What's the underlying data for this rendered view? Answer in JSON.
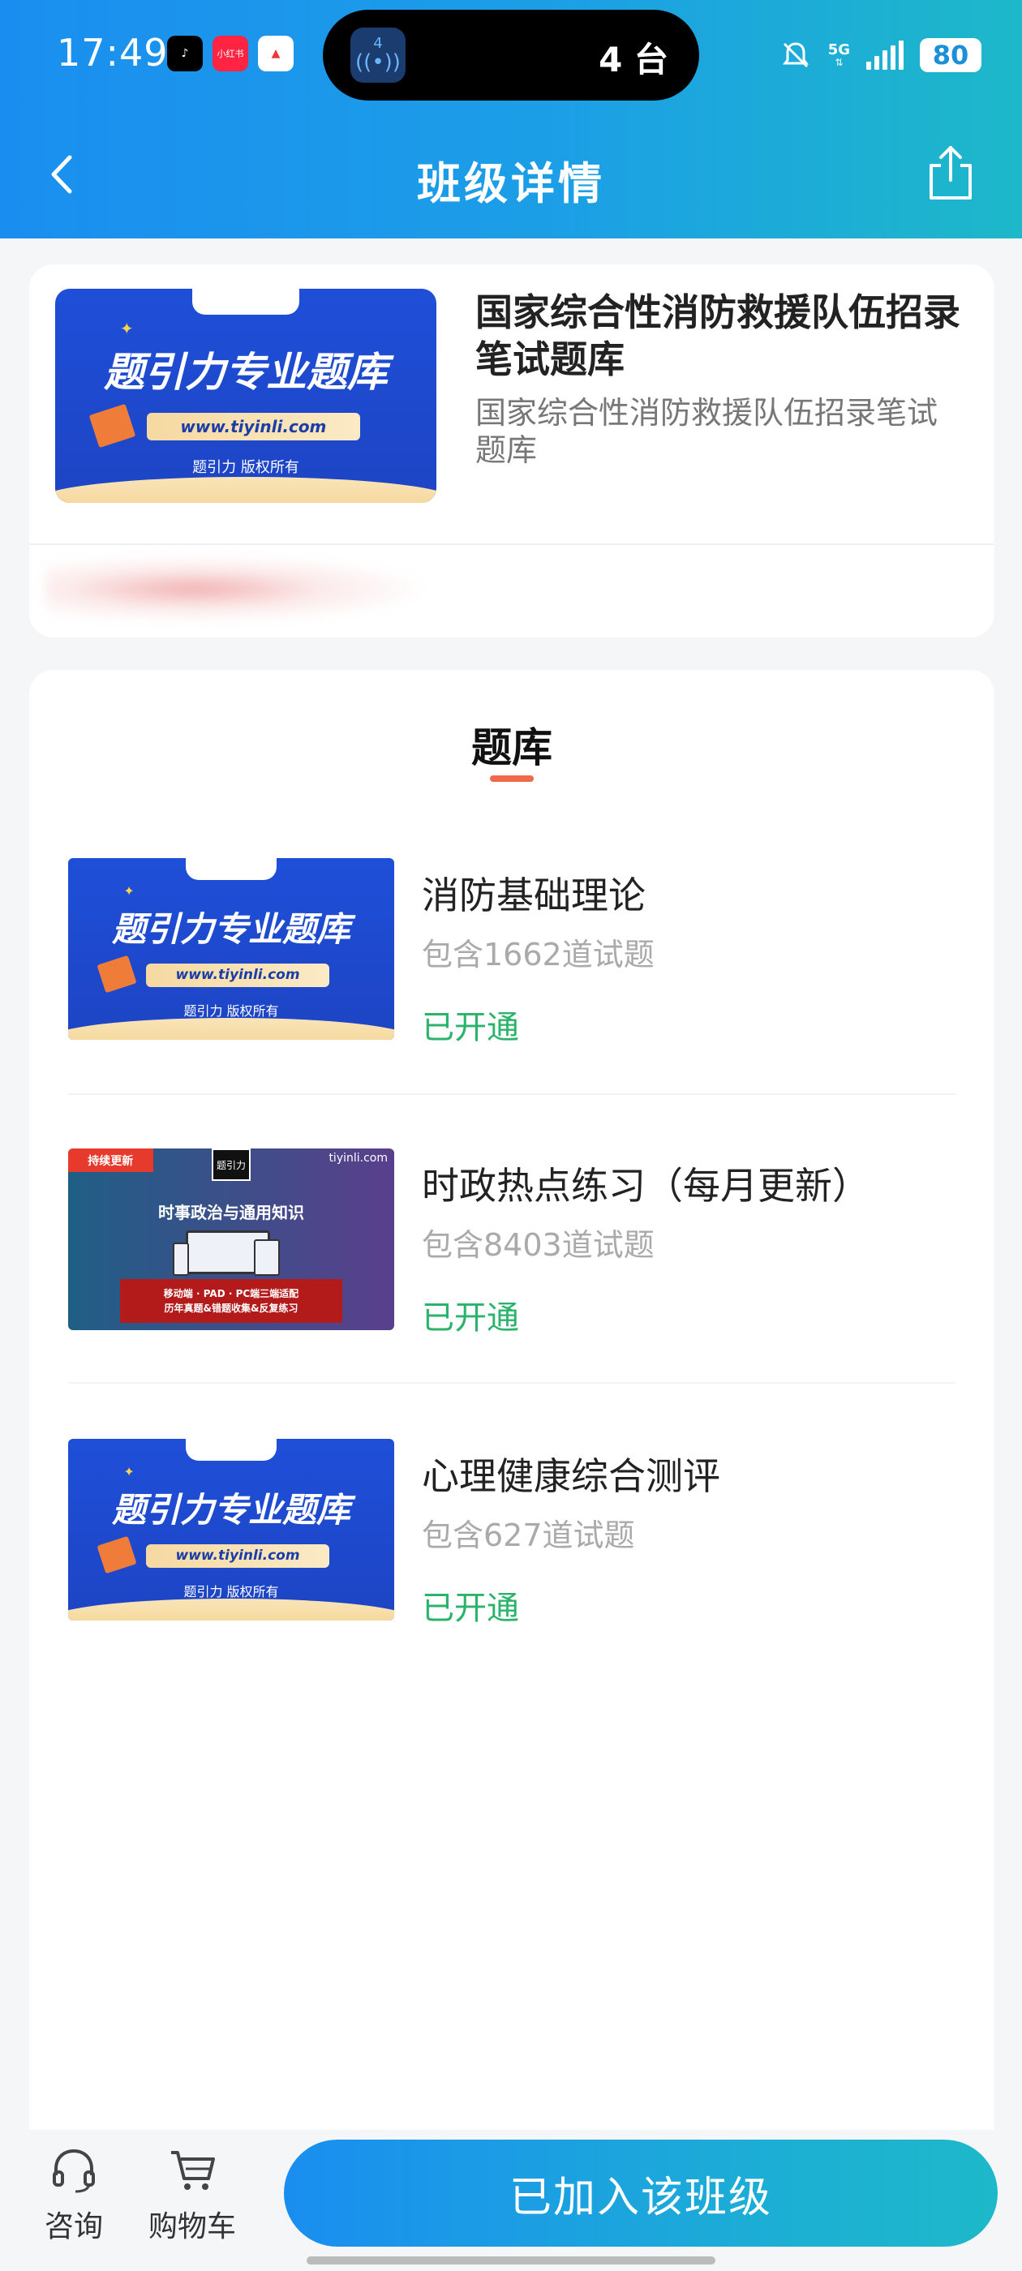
{
  "status_bar": {
    "time": "17:49",
    "apps": [
      {
        "name": "douyin-icon",
        "label": "♪",
        "color": "#000000"
      },
      {
        "name": "xiaohongshu-icon",
        "label": "小红书",
        "color": "#ff2442"
      },
      {
        "name": "alert-app-icon",
        "label": "▲",
        "color": "#e83a3a"
      }
    ],
    "island_badge": "4",
    "island_text": "4 台",
    "network": "5G",
    "battery": "80"
  },
  "nav": {
    "title": "班级详情"
  },
  "class_info": {
    "title": "国家综合性消防救援队伍招录笔试题库",
    "description": "国家综合性消防救援队伍招录笔试题库"
  },
  "cover": {
    "brand": "题引力",
    "headline": "题引力专业题库",
    "url": "www.tiyinli.com",
    "copyright": "题引力 版权所有"
  },
  "question_bank": {
    "section_title": "题库",
    "items": [
      {
        "title": "消防基础理论",
        "count": "包含1662道试题",
        "status": "已开通",
        "cover": "standard"
      },
      {
        "title": "时政热点练习（每月更新）",
        "count": "包含8403道试题",
        "status": "已开通",
        "cover": "politics"
      },
      {
        "title": "心理健康综合测评",
        "count": "包含627道试题",
        "status": "已开通",
        "cover": "standard"
      }
    ]
  },
  "politics_cover": {
    "badge": "持续更新",
    "logo": "题引力",
    "site": "tiyinli.com",
    "headline": "时事政治与通用知识",
    "line1": "移动端 · PAD · PC端三端适配",
    "line2": "历年真题&错题收集&反复练习"
  },
  "bottom_bar": {
    "consult_label": "咨询",
    "cart_label": "购物车",
    "join_button": "已加入该班级"
  },
  "colors": {
    "header_start": "#1a8ef0",
    "header_end": "#1db8c9",
    "status_open": "#2bb36b",
    "accent_underline": "#f06a4a"
  }
}
